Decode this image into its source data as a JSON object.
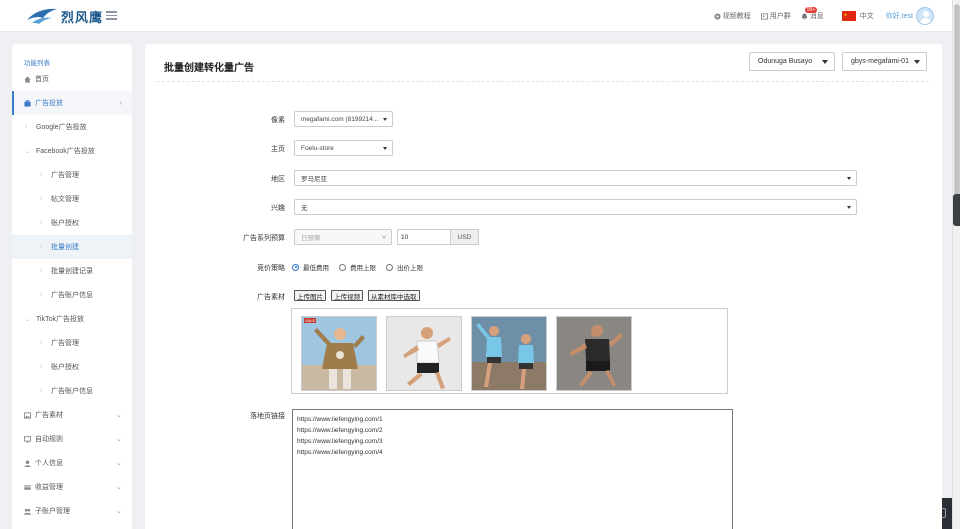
{
  "header": {
    "brand": "烈风鹰",
    "links": [
      {
        "icon": "video-icon",
        "label": "视频教程"
      },
      {
        "icon": "users-icon",
        "label": "用户群"
      },
      {
        "icon": "bell-icon",
        "label": "消息",
        "badge": "99+"
      }
    ],
    "language": "中文",
    "greeting": "你好,test"
  },
  "sidebar": {
    "title": "功能列表",
    "items": [
      {
        "label": "首页",
        "icon": "home-icon"
      },
      {
        "label": "广告投放",
        "icon": "briefcase-icon"
      },
      {
        "label": "Google广告投放"
      },
      {
        "label": "Facebook广告投放"
      },
      {
        "label": "广告管理"
      },
      {
        "label": "帖文管理"
      },
      {
        "label": "账户授权"
      },
      {
        "label": "批量创建"
      },
      {
        "label": "批量创建记录"
      },
      {
        "label": "广告账户信息"
      },
      {
        "label": "TikTok广告投放"
      },
      {
        "label": "广告管理"
      },
      {
        "label": "账户授权"
      },
      {
        "label": "广告账户信息"
      },
      {
        "label": "广告素材",
        "icon": "image-icon"
      },
      {
        "label": "自动规则",
        "icon": "monitor-icon"
      },
      {
        "label": "个人信息",
        "icon": "user-icon"
      },
      {
        "label": "收益管理",
        "icon": "card-icon"
      },
      {
        "label": "子账户管理",
        "icon": "group-icon"
      }
    ]
  },
  "main": {
    "title": "批量创建转化量广告",
    "account_select": "Odunuga Busayo",
    "store_select": "gbys-megafami-01",
    "fields": {
      "pixel_label": "像素",
      "pixel_value": "megafami.com (8199214...",
      "homepage_label": "主页",
      "homepage_value": "Foelu-store",
      "region_label": "地区",
      "region_value": "罗马尼亚",
      "interest_label": "兴趣",
      "interest_value": "无",
      "budget_label": "广告系列预算",
      "budget_type": "日预算",
      "budget_amount": "10",
      "budget_currency": "USD",
      "bid_label": "竞价策略",
      "bid_options": [
        "最低费用",
        "费用上限",
        "出价上限"
      ],
      "material_label": "广告素材",
      "upload_image": "上传图片",
      "upload_video": "上传视频",
      "pick_library": "从素材库中选取",
      "thumb_tag": "SALE",
      "landing_label": "落地页链接",
      "landing_urls": [
        "https://www.liefengying.com/1",
        "https://www.liefengying.com/2",
        "https://www.liefengying.com/3",
        "https://www.liefengying.com/4"
      ]
    }
  },
  "colors": {
    "accent": "#3b7bc8",
    "brand": "#1f5a8c"
  }
}
